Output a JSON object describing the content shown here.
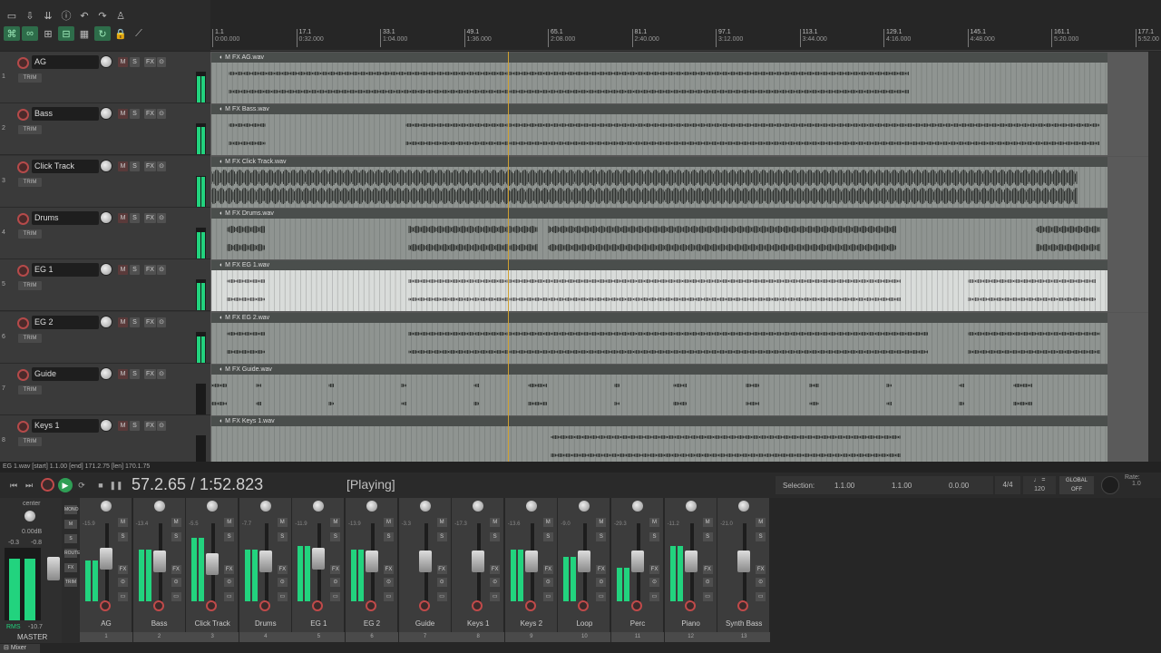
{
  "toolbar": {
    "row1": [
      "new-icon",
      "save-icon",
      "save-as-icon",
      "info-icon",
      "undo-icon",
      "redo-icon",
      "metronome-icon"
    ],
    "row2": [
      "ripple-icon",
      "link-icon",
      "grid-icon",
      "snap-icon",
      "grid-lines-icon",
      "loop-icon",
      "lock-icon",
      "envelope-icon"
    ]
  },
  "ruler": {
    "marks": [
      {
        "bar": "1.1",
        "time": "0:00.000"
      },
      {
        "bar": "17.1",
        "time": "0:32.000"
      },
      {
        "bar": "33.1",
        "time": "1:04.000"
      },
      {
        "bar": "49.1",
        "time": "1:36.000"
      },
      {
        "bar": "65.1",
        "time": "2:08.000"
      },
      {
        "bar": "81.1",
        "time": "2:40.000"
      },
      {
        "bar": "97.1",
        "time": "3:12.000"
      },
      {
        "bar": "113.1",
        "time": "3:44.000"
      },
      {
        "bar": "129.1",
        "time": "4:16.000"
      },
      {
        "bar": "145.1",
        "time": "4:48.000"
      },
      {
        "bar": "161.1",
        "time": "5:20.000"
      },
      {
        "bar": "177.1",
        "time": "5:52.00"
      }
    ]
  },
  "tracks": [
    {
      "num": "1",
      "name": "AG",
      "item": "AG.wav",
      "trim": "TRIM",
      "level": 0.85
    },
    {
      "num": "2",
      "name": "Bass",
      "item": "Bass.wav",
      "trim": "TRIM",
      "level": 0.9
    },
    {
      "num": "3",
      "name": "Click Track",
      "item": "Click Track.wav",
      "trim": "TRIM",
      "level": 0.95
    },
    {
      "num": "4",
      "name": "Drums",
      "item": "Drums.wav",
      "trim": "TRIM",
      "level": 0.85
    },
    {
      "num": "5",
      "name": "EG 1",
      "item": "EG 1.wav",
      "trim": "TRIM",
      "level": 0.9
    },
    {
      "num": "6",
      "name": "EG 2",
      "item": "EG 2.wav",
      "trim": "TRIM",
      "level": 0.85
    },
    {
      "num": "7",
      "name": "Guide",
      "item": "Guide.wav",
      "trim": "TRIM",
      "level": 0
    },
    {
      "num": "8",
      "name": "Keys 1",
      "item": "Keys 1.wav",
      "trim": "TRIM",
      "level": 0
    }
  ],
  "track_buttons": {
    "mute": "M",
    "solo": "S",
    "fx": "FX",
    "io": "⊙"
  },
  "item_buttons": "M FX",
  "status_bar": "EG 1.wav [start] 1.1.00 [end] 171.2.75 [len] 170.1.75",
  "transport": {
    "time": "57.2.65 / 1:52.823",
    "state": "[Playing]",
    "selection_label": "Selection:",
    "sel_start": "1.1.00",
    "sel_end": "1.1.00",
    "sel_len": "0.0.00",
    "time_sig": "4/4",
    "bpm": "120",
    "global_label": "GLOBAL",
    "global_state": "OFF",
    "rate_label": "Rate:",
    "rate_value": "1.0"
  },
  "master": {
    "pan": "center",
    "db": "0.00dB",
    "peak_l": "-0.3",
    "peak_r": "-0.8",
    "rms_label": "RMS",
    "rms_value": "-10.7",
    "name": "MASTER",
    "level_l": 0.85,
    "level_r": 0.85,
    "side_buttons": [
      "MONO",
      "M",
      "S",
      "ROUTE",
      "FX",
      "TRIM"
    ]
  },
  "mixer_channels": [
    {
      "name": "AG",
      "num": "1",
      "db": "-15.9",
      "level": 0.55,
      "fader": 0.55
    },
    {
      "name": "Bass",
      "num": "2",
      "db": "-13.4",
      "level": 0.7,
      "fader": 0.5
    },
    {
      "name": "Click Track",
      "num": "3",
      "db": "-5.5",
      "level": 0.85,
      "fader": 0.45
    },
    {
      "name": "Drums",
      "num": "4",
      "db": "-7.7",
      "level": 0.7,
      "fader": 0.5
    },
    {
      "name": "EG 1",
      "num": "5",
      "db": "-11.9",
      "level": 0.75,
      "fader": 0.55
    },
    {
      "name": "EG 2",
      "num": "6",
      "db": "-13.9",
      "level": 0.7,
      "fader": 0.5
    },
    {
      "name": "Guide",
      "num": "7",
      "db": "-3.3",
      "level": 0,
      "fader": 0.5
    },
    {
      "name": "Keys 1",
      "num": "8",
      "db": "-17.3",
      "level": 0,
      "fader": 0.5
    },
    {
      "name": "Keys 2",
      "num": "9",
      "db": "-13.6",
      "level": 0.7,
      "fader": 0.5
    },
    {
      "name": "Loop",
      "num": "10",
      "db": "-9.0",
      "level": 0.6,
      "fader": 0.5
    },
    {
      "name": "Perc",
      "num": "11",
      "db": "-29.3",
      "level": 0.45,
      "fader": 0.5
    },
    {
      "name": "Piano",
      "num": "12",
      "db": "-11.2",
      "level": 0.75,
      "fader": 0.5
    },
    {
      "name": "Synth Bass",
      "num": "13",
      "db": "-21.0",
      "level": 0,
      "fader": 0.5
    }
  ],
  "mixer_tab": "Mixer",
  "colors": {
    "meter": "#22d37e",
    "play": "#2f9e55",
    "record": "#c04a4a",
    "cursor": "#d0a030",
    "item": "#8f9491",
    "item_selected": "#d9dcda"
  }
}
